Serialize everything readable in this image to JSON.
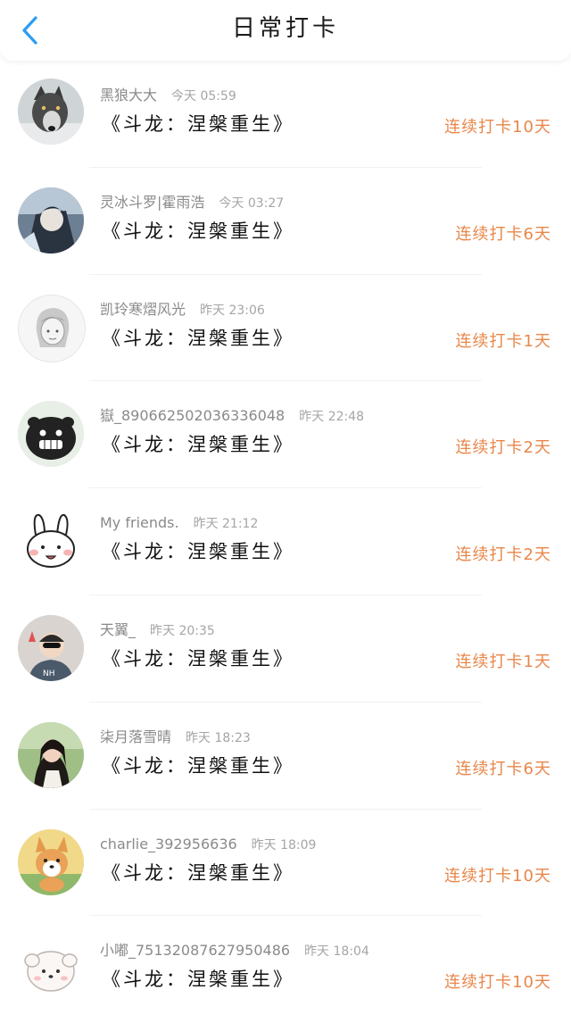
{
  "header": {
    "title": "日常打卡",
    "back_icon": "chevron-left-icon",
    "accent_color": "#2a9df4"
  },
  "colors": {
    "streak": "#e8874a",
    "book": "#111111",
    "meta": "#8a8a8a"
  },
  "items": [
    {
      "username": "黑狼大大",
      "time": "今天 05:59",
      "book": "《斗龙：涅槃重生》",
      "streak": "连续打卡10天",
      "avatar": "wolf-avatar"
    },
    {
      "username": "灵冰斗罗|霍雨浩",
      "time": "今天 03:27",
      "book": "《斗龙：涅槃重生》",
      "streak": "连续打卡6天",
      "avatar": "anime-boy-avatar"
    },
    {
      "username": "凯玲寒熠风光",
      "time": "昨天 23:06",
      "book": "《斗龙：涅槃重生》",
      "streak": "连续打卡1天",
      "avatar": "sketch-girl-avatar"
    },
    {
      "username": "嶽_8906625020363360​48",
      "time": "昨天 22:48",
      "book": "《斗龙：涅槃重生》",
      "streak": "连续打卡2天",
      "avatar": "black-pig-avatar"
    },
    {
      "username": "My friends.",
      "time": "昨天 21:12",
      "book": "《斗龙：涅槃重生》",
      "streak": "连续打卡2天",
      "avatar": "bunny-avatar"
    },
    {
      "username": "天翼_",
      "time": "昨天 20:35",
      "book": "《斗龙：涅槃重生》",
      "streak": "连续打卡1天",
      "avatar": "cartoon-boy-avatar"
    },
    {
      "username": "柒月落雪晴",
      "time": "昨天 18:23",
      "book": "《斗龙：涅槃重生》",
      "streak": "连续打卡6天",
      "avatar": "girl-photo-avatar"
    },
    {
      "username": "charlie_392956636",
      "time": "昨天 18:09",
      "book": "《斗龙：涅槃重生》",
      "streak": "连续打卡10天",
      "avatar": "corgi-avatar"
    },
    {
      "username": "小嘟_75132087627950486",
      "time": "昨天 18:04",
      "book": "《斗龙：涅槃重生》",
      "streak": "连续打卡10天",
      "avatar": "white-dog-avatar"
    }
  ]
}
